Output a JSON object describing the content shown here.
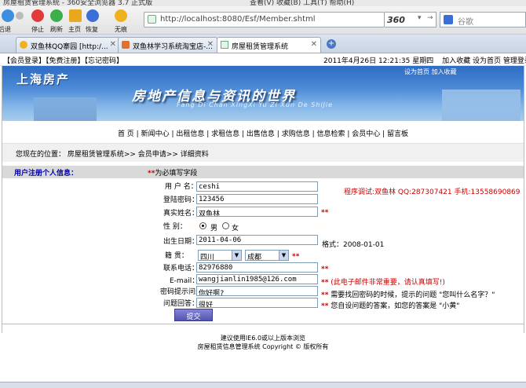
{
  "browser": {
    "title_fragment": "房屋租赁管理系统 - 360安全浏览器 3.7 正式版",
    "menu_fragment": "查看(V)  收藏(B)  工具(T)  帮助(H)",
    "buttons": {
      "back": "后退",
      "stop": "停止",
      "refresh": "刷新",
      "home": "主页",
      "restore": "恢复",
      "private": "无痕"
    },
    "address": "http://localhost:8080/Esf/Member.shtml",
    "brand": "360",
    "search_placeholder": "谷歌",
    "tabs": [
      {
        "label": "双鱼林QQ寨园 [http:/...",
        "active": false
      },
      {
        "label": "双鱼林学习系统淘宝店-...",
        "active": false
      },
      {
        "label": "房屋租赁管理系统",
        "active": true
      }
    ]
  },
  "topbar": {
    "left": "【会员登录】【免费注册】【忘记密码】",
    "date": "2011年4月26日 12:21:35  星期四",
    "links": "加入收藏 设为首页 管理登录"
  },
  "banner": {
    "logo": "上海房产",
    "slogan": "房地产信息与资讯的世界",
    "pinyin": "Fang Di Chan XingXi Yu Zi Xun De ShiJie",
    "top_links": "设为首页  加入收藏"
  },
  "nav": [
    "首 页",
    "新闻中心",
    "出租信息",
    "求租信息",
    "出售信息",
    "求购信息",
    "信息检索",
    "会员中心",
    "留言板"
  ],
  "crumb": "您现在的位置：  房屋租赁管理系统>> 会员申请>> 详细资料",
  "section": {
    "title": "用户注册个人信息：",
    "required_note": "为必填写字段",
    "req_mark": "**"
  },
  "form": {
    "username_label": "用 户 名：",
    "username": "ceshi",
    "password_label": "登陆密码：",
    "password": "123456",
    "realname_label": "真实姓名：",
    "realname": "双鱼林",
    "gender_label": "性    别：",
    "gender_male": "男",
    "gender_female": "女",
    "birthday_label": "出生日期：",
    "birthday": "2011-04-06",
    "birthday_hint": "格式：2008-01-01",
    "hometown_label": "籍    贯：",
    "province": "四川",
    "city": "成都",
    "phone_label": "联系电话：",
    "phone": "82976880",
    "email_label": "E-mail：",
    "email": "wangjianlin1985@126.com",
    "email_hint": "(此电子邮件非常重要，请认真填写!)",
    "question_label": "密码提示问题：",
    "question": "你好啊?",
    "question_hint": "需要找回密码的时候，提示的问题 \"您叫什么名字？\"",
    "answer_label": "问题回答：",
    "answer": "很好",
    "answer_hint": "您自设问题的答案，如您的答案是 \"小黄\"",
    "submit": "提交"
  },
  "tester_note": "程序调试:双鱼林 QQ:287307421 手机:13558690869",
  "footer": {
    "line1": "建议使用IE6.0或以上版本浏览",
    "line2": "房屋租赁信息管理系统 Copyright © 版权所有"
  },
  "colors": {
    "required": "#cc0000",
    "section_title": "#0000aa",
    "submit_bg": "#6a6ac8",
    "banner": "#3b7bd0"
  }
}
